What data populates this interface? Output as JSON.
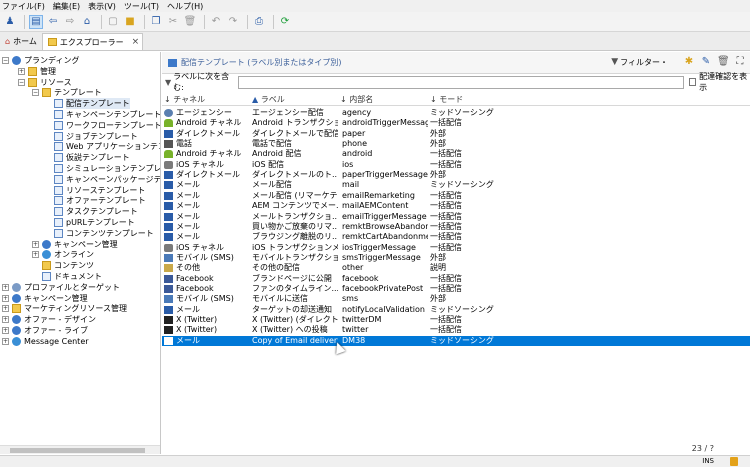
{
  "menu": [
    "ファイル(F)",
    "編集(E)",
    "表示(V)",
    "ツール(T)",
    "ヘルプ(H)"
  ],
  "toolbar": {
    "icons": [
      "user-add-icon",
      "explorer-icon",
      "back-icon",
      "forward-icon",
      "home-folder-icon",
      "new-icon",
      "open-folder-icon",
      "duplicate-icon",
      "cut-icon",
      "delete-icon",
      "undo-icon",
      "redo-icon",
      "print-icon",
      "refresh-icon"
    ]
  },
  "tabs": {
    "home": "ホーム",
    "explorer": "エクスプローラー",
    "close": "×"
  },
  "tree": [
    {
      "label": "プランディング",
      "level": 0,
      "exp": "−",
      "icon": "gear"
    },
    {
      "label": "管理",
      "level": 1,
      "exp": "+",
      "icon": "folder"
    },
    {
      "label": "リソース",
      "level": 1,
      "exp": "−",
      "icon": "folder"
    },
    {
      "label": "テンプレート",
      "level": 2,
      "exp": "−",
      "icon": "folder"
    },
    {
      "label": "配信テンプレート",
      "level": 3,
      "exp": "",
      "icon": "doc",
      "selected": true
    },
    {
      "label": "キャンペーンテンプレート",
      "level": 3,
      "exp": "",
      "icon": "doc"
    },
    {
      "label": "ワークフローテンプレート",
      "level": 3,
      "exp": "",
      "icon": "doc"
    },
    {
      "label": "ジョブテンプレート",
      "level": 3,
      "exp": "",
      "icon": "doc"
    },
    {
      "label": "Web アプリケーションテンプレート",
      "level": 3,
      "exp": "",
      "icon": "doc"
    },
    {
      "label": "仮説テンプレート",
      "level": 3,
      "exp": "",
      "icon": "doc"
    },
    {
      "label": "シミュレーションテンプレート",
      "level": 3,
      "exp": "",
      "icon": "doc"
    },
    {
      "label": "キャンペーンパッケージテンプレート",
      "level": 3,
      "exp": "",
      "icon": "doc"
    },
    {
      "label": "リソーステンプレート",
      "level": 3,
      "exp": "",
      "icon": "doc"
    },
    {
      "label": "オファーテンプレート",
      "level": 3,
      "exp": "",
      "icon": "doc"
    },
    {
      "label": "タスクテンプレート",
      "level": 3,
      "exp": "",
      "icon": "doc"
    },
    {
      "label": "pURLテンプレート",
      "level": 3,
      "exp": "",
      "icon": "doc"
    },
    {
      "label": "コンテンツテンプレート",
      "level": 3,
      "exp": "",
      "icon": "doc"
    },
    {
      "label": "キャンペーン管理",
      "level": 2,
      "exp": "+",
      "icon": "gear"
    },
    {
      "label": "オンライン",
      "level": 2,
      "exp": "+",
      "icon": "globe"
    },
    {
      "label": "コンテンツ",
      "level": 2,
      "exp": "",
      "icon": "folder"
    },
    {
      "label": "ドキュメント",
      "level": 2,
      "exp": "",
      "icon": "doc"
    },
    {
      "label": "プロファイルとターゲット",
      "level": 0,
      "exp": "+",
      "icon": "person"
    },
    {
      "label": "キャンペーン管理",
      "level": 0,
      "exp": "+",
      "icon": "gear"
    },
    {
      "label": "マーケティングリソース管理",
      "level": 0,
      "exp": "+",
      "icon": "folder"
    },
    {
      "label": "オファー - デザイン",
      "level": 0,
      "exp": "+",
      "icon": "gear"
    },
    {
      "label": "オファー - ライブ",
      "level": 0,
      "exp": "+",
      "icon": "gear"
    },
    {
      "label": "Message Center",
      "level": 0,
      "exp": "+",
      "icon": "globe"
    }
  ],
  "panel": {
    "title": "配信テンプレート (ラベル別またはタイプ別)",
    "filter_button": "フィルター・",
    "filter_label": "ラベルに次を含む:",
    "filter_value": "",
    "checkbox_label": "配達確認を表示",
    "count": "23 / ?"
  },
  "columns": [
    "チャネル",
    "ラベル",
    "内部名",
    "モード"
  ],
  "rows": [
    {
      "icon": "agency",
      "channel": "エージェンシー",
      "label": "エージェンシー配信",
      "internal": "agency",
      "mode": "ミッドソーシング"
    },
    {
      "icon": "android",
      "channel": "Android チャネル",
      "label": "Android トランザクショ...",
      "internal": "androidTriggerMessage",
      "mode": "一括配信"
    },
    {
      "icon": "mail",
      "channel": "ダイレクトメール",
      "label": "ダイレクトメールで配信",
      "internal": "paper",
      "mode": "外部"
    },
    {
      "icon": "phone",
      "channel": "電話",
      "label": "電話で配信",
      "internal": "phone",
      "mode": "外部"
    },
    {
      "icon": "android",
      "channel": "Android チャネル",
      "label": "Android 配信",
      "internal": "android",
      "mode": "一括配信"
    },
    {
      "icon": "ios",
      "channel": "iOS チャネル",
      "label": "iOS 配信",
      "internal": "ios",
      "mode": "一括配信"
    },
    {
      "icon": "mail",
      "channel": "ダイレクトメール",
      "label": "ダイレクトメールのト...",
      "internal": "paperTriggerMessage",
      "mode": "外部"
    },
    {
      "icon": "mail",
      "channel": "メール",
      "label": "メール配信",
      "internal": "mail",
      "mode": "ミッドソーシング"
    },
    {
      "icon": "mail",
      "channel": "メール",
      "label": "メール配信 (リマーケテ...",
      "internal": "emailRemarketing",
      "mode": "一括配信"
    },
    {
      "icon": "mail",
      "channel": "メール",
      "label": "AEM コンテンツでメー...",
      "internal": "mailAEMContent",
      "mode": "一括配信"
    },
    {
      "icon": "mail",
      "channel": "メール",
      "label": "メールトランザクショ...",
      "internal": "emailTriggerMessage",
      "mode": "一括配信"
    },
    {
      "icon": "mail",
      "channel": "メール",
      "label": "買い物かご放棄のリマ...",
      "internal": "remktBrowseAbandonm...",
      "mode": "一括配信"
    },
    {
      "icon": "mail",
      "channel": "メール",
      "label": "ブラウジング離脱のリ...",
      "internal": "remktCartAbandonme...",
      "mode": "一括配信"
    },
    {
      "icon": "ios",
      "channel": "iOS チャネル",
      "label": "iOS トランザクションメ...",
      "internal": "iosTriggerMessage",
      "mode": "一括配信"
    },
    {
      "icon": "sms",
      "channel": "モバイル (SMS)",
      "label": "モバイルトランザクショ...",
      "internal": "smsTriggerMessage",
      "mode": "外部"
    },
    {
      "icon": "other",
      "channel": "その他",
      "label": "その他の配信",
      "internal": "other",
      "mode": "説明"
    },
    {
      "icon": "fb",
      "channel": "Facebook",
      "label": "ブランドページに公開",
      "internal": "facebook",
      "mode": "一括配信"
    },
    {
      "icon": "fb",
      "channel": "Facebook",
      "label": "ファンのタイムライン...",
      "internal": "facebookPrivatePost",
      "mode": "一括配信"
    },
    {
      "icon": "sms",
      "channel": "モバイル (SMS)",
      "label": "モバイルに送信",
      "internal": "sms",
      "mode": "外部"
    },
    {
      "icon": "mail",
      "channel": "メール",
      "label": "ターゲットの却送通知",
      "internal": "notifyLocalValidation",
      "mode": "ミッドソーシング"
    },
    {
      "icon": "x",
      "channel": "X (Twitter)",
      "label": "X (Twitter) (ダイレクトメ...",
      "internal": "twitterDM",
      "mode": "一括配信"
    },
    {
      "icon": "x",
      "channel": "X (Twitter)",
      "label": "X (Twitter) への投稿",
      "internal": "twitter",
      "mode": "一括配信"
    },
    {
      "icon": "mail",
      "channel": "メール",
      "label": "Copy of Email delivery",
      "internal": "DM38",
      "mode": "ミッドソーシング",
      "selected": true
    }
  ],
  "status": {
    "ins": "INS"
  }
}
